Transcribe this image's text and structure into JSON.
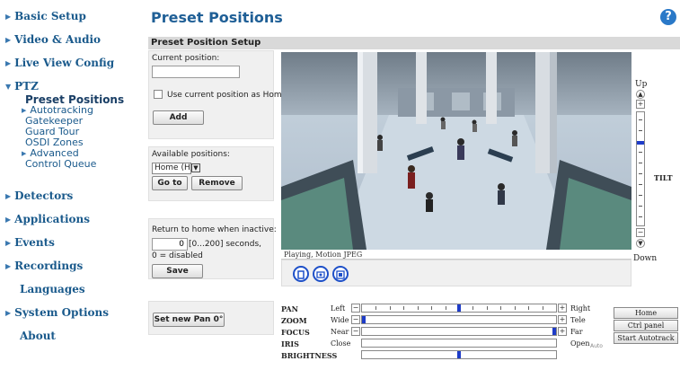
{
  "nav": {
    "basic_setup": "Basic Setup",
    "video_audio": "Video & Audio",
    "live_view_config": "Live View Config",
    "ptz": "PTZ",
    "ptz_items": [
      "Preset Positions",
      "Autotracking",
      "Gatekeeper",
      "Guard Tour",
      "OSDI Zones",
      "Advanced",
      "Control Queue"
    ],
    "detectors": "Detectors",
    "applications": "Applications",
    "events": "Events",
    "recordings": "Recordings",
    "languages": "Languages",
    "system_options": "System Options",
    "about": "About"
  },
  "header": {
    "title": "Preset Positions",
    "help": "?"
  },
  "section": {
    "title": "Preset Position Setup"
  },
  "setup": {
    "current_position_label": "Current position:",
    "current_position_value": "",
    "use_home_label": "Use current position as Home",
    "add_button": "Add",
    "available_label": "Available positions:",
    "available_selected": "Home (H)",
    "goto_button": "Go to",
    "remove_button": "Remove",
    "return_label": "Return to home when inactive:",
    "return_value": "0",
    "return_range": "[0...200] seconds,",
    "return_note": "0 = disabled",
    "save_button": "Save",
    "pan_button": "Set new Pan 0°"
  },
  "video": {
    "status": "Playing, Motion JPEG"
  },
  "tilt": {
    "up": "Up",
    "down": "Down",
    "label": "TILT",
    "level": 0.26
  },
  "sliders": [
    {
      "name": "PAN",
      "low": "Left",
      "high": "Right",
      "value": 0.5
    },
    {
      "name": "ZOOM",
      "low": "Wide",
      "high": "Tele",
      "value": 0.0
    },
    {
      "name": "FOCUS",
      "low": "Near",
      "high": "Far",
      "value": 1.0
    },
    {
      "name": "IRIS",
      "low": "Close",
      "high": "Open",
      "value": null
    },
    {
      "name": "BRIGHTNESS",
      "low": "",
      "high": "",
      "value": 0.5
    }
  ],
  "iris_mode": "Auto",
  "right_buttons": {
    "home": "Home",
    "ctrl_panel": "Ctrl panel",
    "autotrack": "Start Autotrack"
  },
  "colors": {
    "accent": "#1f5f96",
    "thumb": "#1e3cc8",
    "section_bar": "#d9d9d9"
  }
}
